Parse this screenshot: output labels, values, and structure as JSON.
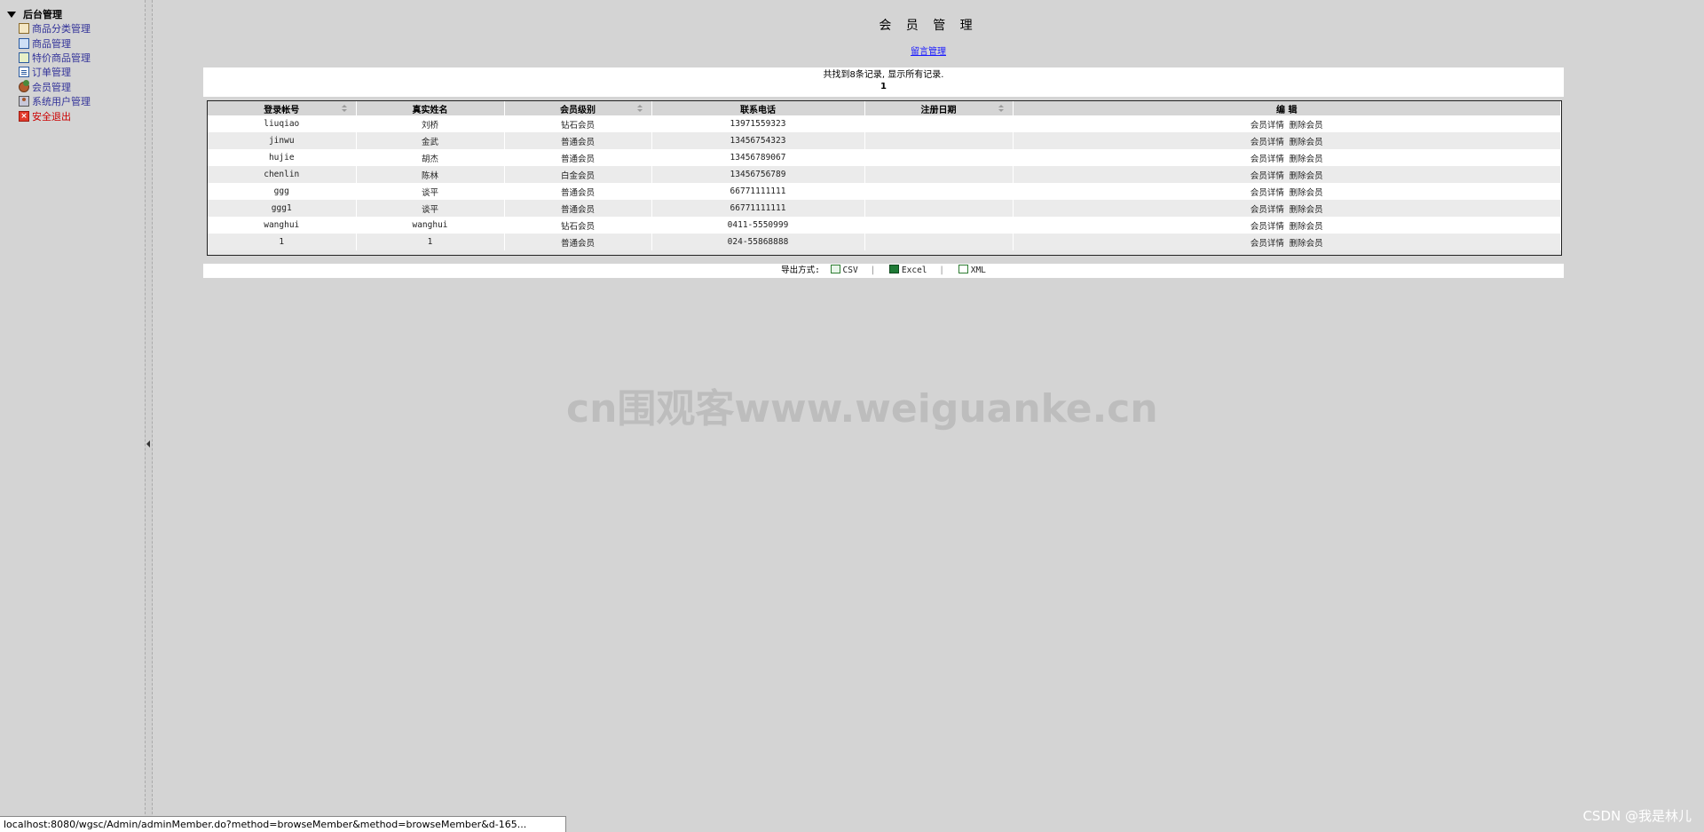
{
  "sidebar": {
    "root_label": "后台管理",
    "items": [
      {
        "label": "商品分类管理",
        "icon": "category-icon"
      },
      {
        "label": "商品管理",
        "icon": "product-icon"
      },
      {
        "label": "特价商品管理",
        "icon": "special-product-icon"
      },
      {
        "label": "订单管理",
        "icon": "order-icon"
      },
      {
        "label": "会员管理",
        "icon": "member-icon"
      },
      {
        "label": "系统用户管理",
        "icon": "system-user-icon"
      },
      {
        "label": "安全退出",
        "icon": "exit-icon"
      }
    ]
  },
  "main": {
    "title": "会 员 管 理",
    "sub_link": "留言管理",
    "records_text": "共找到8条记录, 显示所有记录.",
    "page_number": "1",
    "table": {
      "headers": [
        "登录帐号",
        "真实姓名",
        "会员级别",
        "联系电话",
        "注册日期",
        "编 辑"
      ],
      "rows": [
        {
          "account": "liuqiao",
          "name": "刘桥",
          "level": "钻石会员",
          "phone": "13971559323",
          "date": "",
          "detail": "会员详情",
          "delete": "删除会员"
        },
        {
          "account": "jinwu",
          "name": "金武",
          "level": "普通会员",
          "phone": "13456754323",
          "date": "",
          "detail": "会员详情",
          "delete": "删除会员"
        },
        {
          "account": "hujie",
          "name": "胡杰",
          "level": "普通会员",
          "phone": "13456789067",
          "date": "",
          "detail": "会员详情",
          "delete": "删除会员"
        },
        {
          "account": "chenlin",
          "name": "陈林",
          "level": "白金会员",
          "phone": "13456756789",
          "date": "",
          "detail": "会员详情",
          "delete": "删除会员"
        },
        {
          "account": "ggg",
          "name": "谈平",
          "level": "普通会员",
          "phone": "66771111111",
          "date": "",
          "detail": "会员详情",
          "delete": "删除会员"
        },
        {
          "account": "ggg1",
          "name": "谈平",
          "level": "普通会员",
          "phone": "66771111111",
          "date": "",
          "detail": "会员详情",
          "delete": "删除会员"
        },
        {
          "account": "wanghui",
          "name": "wanghui",
          "level": "钻石会员",
          "phone": "0411-5550999",
          "date": "",
          "detail": "会员详情",
          "delete": "删除会员"
        },
        {
          "account": "1",
          "name": "1",
          "level": "普通会员",
          "phone": "024-55868888",
          "date": "",
          "detail": "会员详情",
          "delete": "删除会员"
        }
      ]
    },
    "export": {
      "label": "导出方式:",
      "csv": "CSV",
      "excel": "Excel",
      "xml": "XML"
    }
  },
  "watermark": "cn围观客www.weiguanke.cn",
  "status_url": "localhost:8080/wgsc/Admin/adminMember.do?method=browseMember&method=browseMember&d-165...",
  "credit": "CSDN @我是林儿"
}
